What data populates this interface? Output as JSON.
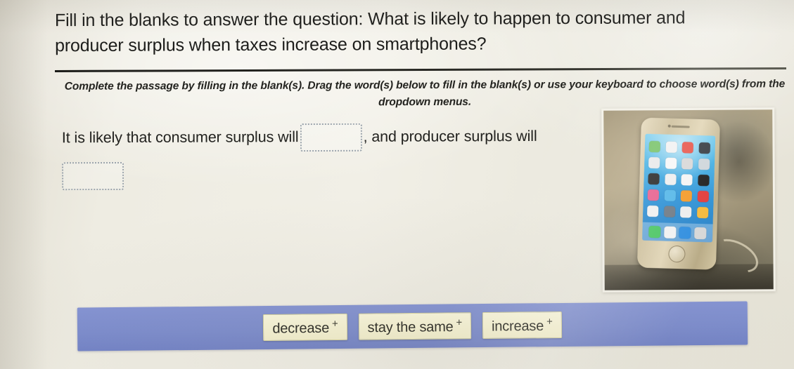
{
  "question": {
    "text": "Fill in the blanks to answer the question: What is likely to happen to consumer and producer surplus when taxes increase on smartphones?"
  },
  "instructions": {
    "text": "Complete the passage by filling in the blank(s). Drag the word(s) below to fill in the blank(s) or use your keyboard to choose word(s) from the dropdown menus."
  },
  "passage": {
    "segment_1": "It is likely that consumer surplus will",
    "blank_1_value": "",
    "segment_2": ", and producer surplus will",
    "blank_2_value": ""
  },
  "word_bank": {
    "options": [
      {
        "label": "decrease",
        "marker": "+"
      },
      {
        "label": "stay the same",
        "marker": "+"
      },
      {
        "label": "increase",
        "marker": "+"
      }
    ]
  },
  "photo": {
    "alt": "smartphone-photo",
    "screen_icons": [
      "#79c36a",
      "#f2f2f2",
      "#e85a4f",
      "#3a3f45",
      "#eaeaea",
      "#f7f7f7",
      "#d8d8d8",
      "#cfd6db",
      "#2a2a2a",
      "#efefef",
      "#f4f4f4",
      "#1f1f1f",
      "#e8618f",
      "#55b7e8",
      "#f49b2a",
      "#e23b3b",
      "#f0f0f0",
      "#6f7a85",
      "#ededed",
      "#f6b93b"
    ],
    "dock_icons": [
      "#4cc764",
      "#f2f2f2",
      "#2f8ee0",
      "#d7d7d7"
    ]
  },
  "colors": {
    "page_background": "#eceadf",
    "word_bank_bar": "#7c8ccd",
    "chip_background": "#f5f1cf",
    "blank_border": "#9aa3ab",
    "rule": "#1b1b18"
  }
}
